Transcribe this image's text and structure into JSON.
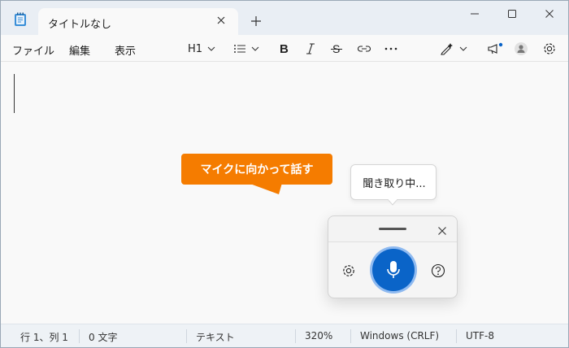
{
  "tab": {
    "title": "タイトルなし"
  },
  "menu": {
    "file": "ファイル",
    "edit": "編集",
    "view": "表示"
  },
  "toolbar": {
    "heading": "H1"
  },
  "callout": {
    "text": "マイクに向かって話す",
    "color": "#f57c00"
  },
  "voice": {
    "status": "聞き取り中..."
  },
  "status": {
    "position": "行 1、列 1",
    "chars": "0 文字",
    "mode": "テキスト",
    "zoom": "320%",
    "line_ending": "Windows (CRLF)",
    "encoding": "UTF-8"
  },
  "colors": {
    "accent": "#0a64c8",
    "notify_dot": "#0a64c8"
  },
  "icons": [
    "notepad-icon",
    "close-icon",
    "plus-icon",
    "minimize-icon",
    "maximize-icon",
    "list-icon",
    "bold-icon",
    "italic-icon",
    "strikethrough-icon",
    "link-icon",
    "more-icon",
    "copilot-pen-icon",
    "megaphone-icon",
    "account-icon",
    "settings-icon",
    "microphone-icon",
    "help-icon"
  ]
}
